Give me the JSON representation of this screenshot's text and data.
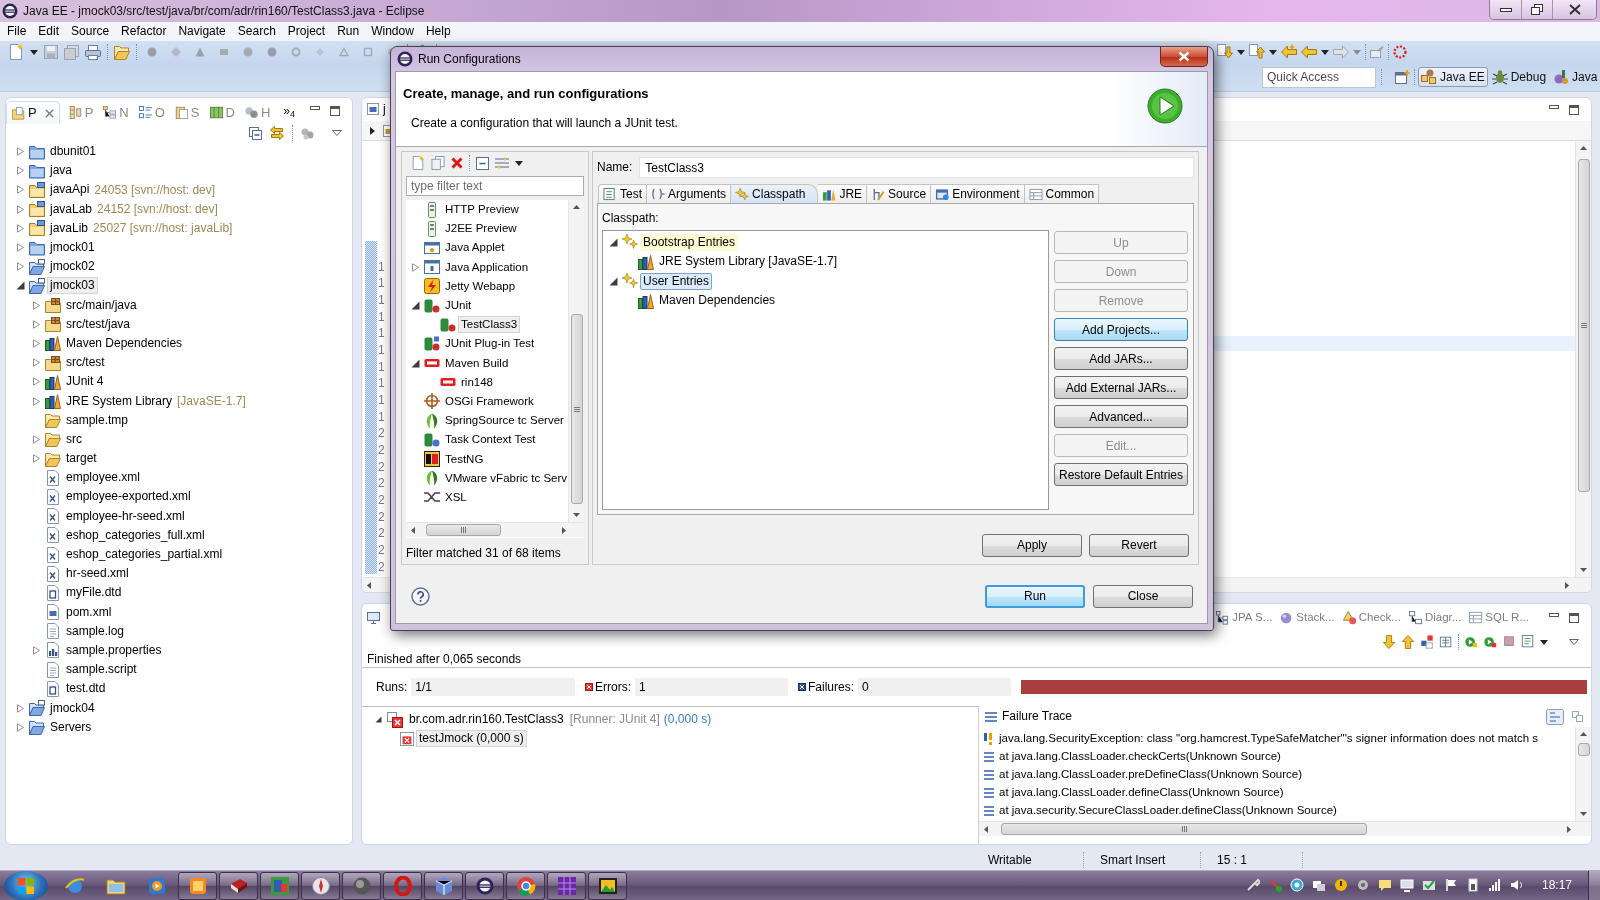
{
  "window": {
    "title": "Java EE - jmock03/src/test/java/br/com/adr/rin160/TestClass3.java - Eclipse"
  },
  "menu": [
    "File",
    "Edit",
    "Source",
    "Refactor",
    "Navigate",
    "Search",
    "Project",
    "Run",
    "Window",
    "Help"
  ],
  "toolbar": {
    "quick_access": {
      "placeholder": "Quick Access"
    },
    "perspectives": [
      {
        "label": "Java EE",
        "selected": true
      },
      {
        "label": "Debug",
        "selected": false
      },
      {
        "label": "Java",
        "selected": false
      }
    ]
  },
  "project_explorer": {
    "tabs": [
      {
        "label": "P",
        "selected": true
      },
      {
        "label": "P",
        "selected": false
      },
      {
        "label": "N",
        "selected": false
      },
      {
        "label": "O",
        "selected": false
      },
      {
        "label": "S",
        "selected": false
      },
      {
        "label": "D",
        "selected": false
      },
      {
        "label": "H",
        "selected": false
      }
    ],
    "overflow": "»$_{4}$",
    "tree": [
      {
        "label": "dbunit01",
        "kind": "project",
        "expanded": false,
        "selected": false
      },
      {
        "label": "java",
        "kind": "project",
        "expanded": false,
        "selected": false
      },
      {
        "label": "javaApi",
        "decoration": "24053 [svn://host: dev]",
        "kind": "svn-project",
        "expanded": false,
        "selected": false
      },
      {
        "label": "javaLab",
        "decoration": "24152 [svn://host: dev]",
        "kind": "svn-project",
        "expanded": false,
        "selected": false
      },
      {
        "label": "javaLib",
        "decoration": "25027 [svn://host: javaLib]",
        "kind": "svn-project",
        "expanded": false,
        "selected": false
      },
      {
        "label": "jmock01",
        "kind": "project",
        "expanded": false,
        "selected": false
      },
      {
        "label": "jmock02",
        "kind": "maven-project",
        "expanded": false,
        "selected": false
      },
      {
        "label": "jmock03",
        "kind": "maven-project",
        "expanded": true,
        "selected": true,
        "children": [
          {
            "label": "src/main/java",
            "kind": "source-folder",
            "expanded": false,
            "selected": false
          },
          {
            "label": "src/test/java",
            "kind": "source-folder",
            "expanded": false,
            "selected": false
          },
          {
            "label": "Maven Dependencies",
            "kind": "library",
            "expanded": false,
            "selected": false
          },
          {
            "label": "src/test",
            "kind": "source-folder",
            "expanded": false,
            "selected": false
          },
          {
            "label": "JUnit 4",
            "kind": "library",
            "expanded": false,
            "selected": false
          },
          {
            "label": "JRE System Library",
            "decoration": "[JavaSE-1.7]",
            "kind": "library",
            "expanded": false,
            "selected": false
          },
          {
            "label": "sample.tmp",
            "kind": "folder",
            "selected": false
          },
          {
            "label": "src",
            "kind": "folder",
            "expanded": false,
            "selected": false
          },
          {
            "label": "target",
            "kind": "folder",
            "expanded": false,
            "selected": false
          },
          {
            "label": "employee.xml",
            "kind": "xml",
            "selected": false
          },
          {
            "label": "employee-exported.xml",
            "kind": "xml",
            "selected": false
          },
          {
            "label": "employee-hr-seed.xml",
            "kind": "xml",
            "selected": false
          },
          {
            "label": "eshop_categories_full.xml",
            "kind": "xml",
            "selected": false
          },
          {
            "label": "eshop_categories_partial.xml",
            "kind": "xml",
            "selected": false
          },
          {
            "label": "hr-seed.xml",
            "kind": "xml",
            "selected": false
          },
          {
            "label": "myFile.dtd",
            "kind": "dtd",
            "selected": false
          },
          {
            "label": "pom.xml",
            "kind": "pom",
            "selected": false
          },
          {
            "label": "sample.log",
            "kind": "text",
            "selected": false
          },
          {
            "label": "sample.properties",
            "kind": "properties",
            "expanded": false,
            "selected": false
          },
          {
            "label": "sample.script",
            "kind": "text",
            "selected": false
          },
          {
            "label": "test.dtd",
            "kind": "dtd",
            "selected": false
          }
        ]
      },
      {
        "label": "jmock04",
        "kind": "maven-project",
        "expanded": false,
        "selected": false
      },
      {
        "label": "Servers",
        "kind": "open-project",
        "expanded": false,
        "selected": false
      }
    ]
  },
  "editor": {
    "tab": {
      "label": "j"
    },
    "line_numbers": [
      "1",
      "1",
      "1",
      "1",
      "1",
      "1",
      "1",
      "1",
      "1",
      "1",
      "2",
      "2",
      "2",
      "2",
      "2",
      "2",
      "2",
      "2",
      "2"
    ]
  },
  "dialog": {
    "title": "Run Configurations",
    "heading": "Create, manage, and run configurations",
    "description": "Create a configuration that will launch a JUnit test.",
    "filter": {
      "placeholder": "type filter text"
    },
    "config_types": [
      {
        "label": "HTTP Preview",
        "kind": "server",
        "selected": false
      },
      {
        "label": "J2EE Preview",
        "kind": "server",
        "selected": false
      },
      {
        "label": "Java Applet",
        "kind": "applet",
        "selected": false
      },
      {
        "label": "Java Application",
        "kind": "app",
        "expanded": false,
        "selected": false
      },
      {
        "label": "Jetty Webapp",
        "kind": "jetty",
        "selected": false
      },
      {
        "label": "JUnit",
        "kind": "junit",
        "expanded": true,
        "selected": false,
        "children": [
          {
            "label": "TestClass3",
            "kind": "junit",
            "selected": true
          }
        ]
      },
      {
        "label": "JUnit Plug-in Test",
        "kind": "junit-plugin",
        "selected": false
      },
      {
        "label": "Maven Build",
        "kind": "maven",
        "expanded": true,
        "selected": false,
        "children": [
          {
            "label": "rin148",
            "kind": "maven",
            "selected": false
          }
        ]
      },
      {
        "label": "OSGi Framework",
        "kind": "osgi",
        "selected": false
      },
      {
        "label": "SpringSource tc Server",
        "kind": "spring",
        "selected": false
      },
      {
        "label": "Task Context Test",
        "kind": "task",
        "selected": false
      },
      {
        "label": "TestNG",
        "kind": "testng",
        "selected": false
      },
      {
        "label": "VMware vFabric tc Serv",
        "kind": "spring",
        "selected": false
      },
      {
        "label": "XSL",
        "kind": "xsl",
        "selected": false
      }
    ],
    "filter_status": "Filter matched 31 of 68 items",
    "name": {
      "label": "Name:",
      "value": "TestClass3"
    },
    "tabs": [
      {
        "label": "Test",
        "selected": false
      },
      {
        "label": "Arguments",
        "selected": false
      },
      {
        "label": "Classpath",
        "selected": true
      },
      {
        "label": "JRE",
        "selected": false
      },
      {
        "label": "Source",
        "selected": false
      },
      {
        "label": "Environment",
        "selected": false
      },
      {
        "label": "Common",
        "selected": false
      }
    ],
    "classpath": {
      "label": "Classpath:",
      "entries": [
        {
          "label": "Bootstrap Entries",
          "kind": "entries",
          "expanded": true,
          "selected": false,
          "highlighted": true,
          "children": [
            {
              "label": "JRE System Library [JavaSE-1.7]",
              "kind": "library",
              "selected": false,
              "highlighted": false
            }
          ]
        },
        {
          "label": "User Entries",
          "kind": "entries",
          "expanded": true,
          "selected": true,
          "highlighted": false,
          "children": [
            {
              "label": "Maven Dependencies",
              "kind": "library",
              "selected": false,
              "highlighted": false
            }
          ]
        }
      ]
    },
    "side_buttons": [
      {
        "label": "Up",
        "disabled": true,
        "focused": false
      },
      {
        "label": "Down",
        "disabled": true,
        "focused": false
      },
      {
        "label": "Remove",
        "disabled": true,
        "focused": false
      },
      {
        "label": "Add Projects...",
        "disabled": false,
        "focused": true
      },
      {
        "label": "Add JARs...",
        "disabled": false,
        "focused": false
      },
      {
        "label": "Add External JARs...",
        "disabled": false,
        "focused": false
      },
      {
        "label": "Advanced...",
        "disabled": false,
        "focused": false
      },
      {
        "label": "Edit...",
        "disabled": true,
        "focused": false
      },
      {
        "label": "Restore Default Entries",
        "disabled": false,
        "focused": false
      }
    ],
    "apply_buttons": [
      {
        "label": "Apply"
      },
      {
        "label": "Revert"
      }
    ],
    "buttons": [
      {
        "label": "Run",
        "default": true
      },
      {
        "label": "Close",
        "default": false
      }
    ]
  },
  "junit": {
    "view_tabs": [
      {
        "label": "JPA S..."
      },
      {
        "label": "Stack..."
      },
      {
        "label": "Check..."
      },
      {
        "label": "Diagr..."
      },
      {
        "label": "SQL R..."
      }
    ],
    "summary": "Finished after 0,065 seconds",
    "counters": [
      {
        "kind": "runs",
        "label": "Runs:",
        "value": "1/1"
      },
      {
        "kind": "errors",
        "label": "Errors:",
        "value": "1"
      },
      {
        "kind": "failures",
        "label": "Failures:",
        "value": "0"
      }
    ],
    "progress": {
      "level": 1,
      "failed": true
    },
    "tests": [
      {
        "label": "br.com.adr.rin160.TestClass3",
        "runner": "[Runner: JUnit 4]",
        "time": "(0,000 s)",
        "expanded": true,
        "selected": false,
        "children": [
          {
            "label": "testJmock (0,000 s)",
            "selected": true
          }
        ]
      }
    ],
    "failure_trace": {
      "title": "Failure Trace",
      "lines": [
        {
          "kind": "exception",
          "text": "java.lang.SecurityException: class \"org.hamcrest.TypeSafeMatcher\"'s signer information does not match s"
        },
        {
          "kind": "frame",
          "text": "at java.lang.ClassLoader.checkCerts(Unknown Source)"
        },
        {
          "kind": "frame",
          "text": "at java.lang.ClassLoader.preDefineClass(Unknown Source)"
        },
        {
          "kind": "frame",
          "text": "at java.lang.ClassLoader.defineClass(Unknown Source)"
        },
        {
          "kind": "frame",
          "text": "at java.security.SecureClassLoader.defineClass(Unknown Source)"
        }
      ]
    }
  },
  "status_bar": [
    "Writable",
    "Smart Insert",
    "15 : 1"
  ],
  "taskbar": {
    "items": [
      {
        "running": false
      },
      {
        "running": false
      },
      {
        "running": false
      },
      {
        "running": true
      },
      {
        "running": true
      },
      {
        "running": true
      },
      {
        "running": true
      },
      {
        "running": true
      },
      {
        "running": true
      },
      {
        "running": true
      },
      {
        "running": true
      },
      {
        "running": true
      },
      {
        "running": true
      },
      {
        "running": true
      }
    ],
    "clock": "18:17"
  }
}
